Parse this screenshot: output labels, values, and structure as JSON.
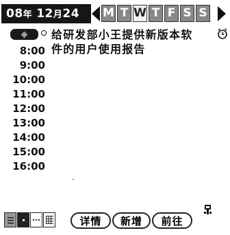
{
  "header": {
    "year_num": "08",
    "year_unit": "年",
    "month_num": "12",
    "month_unit": "月",
    "day_num": "24"
  },
  "week": {
    "days": [
      {
        "label": "M",
        "selected": false
      },
      {
        "label": "T",
        "selected": false
      },
      {
        "label": "W",
        "selected": true
      },
      {
        "label": "T",
        "selected": false
      },
      {
        "label": "F",
        "selected": false
      },
      {
        "label": "S",
        "selected": false
      },
      {
        "label": "S",
        "selected": false
      }
    ]
  },
  "event": {
    "text": "给研发部小王提供新版本软\n件的用户使用报告",
    "icons": [
      "note-pill-icon",
      "repeat-bullet-icon",
      "alarm-icon"
    ]
  },
  "times": [
    "8:00",
    "9:00",
    "10:00",
    "11:00",
    "12:00",
    "13:00",
    "14:00",
    "15:00",
    "16:00"
  ],
  "toolbar": {
    "view_icons": [
      "day-view-icon",
      "week-view-icon",
      "list-view-icon",
      "month-view-icon"
    ],
    "details_label": "详情",
    "new_label": "新增",
    "goto_label": "前往",
    "graffiti_icon": "graffiti-shift-icon"
  },
  "colors": {
    "header_bg": "#161616",
    "day_inactive": "#888888",
    "day_selected": "#f1f1f1"
  }
}
